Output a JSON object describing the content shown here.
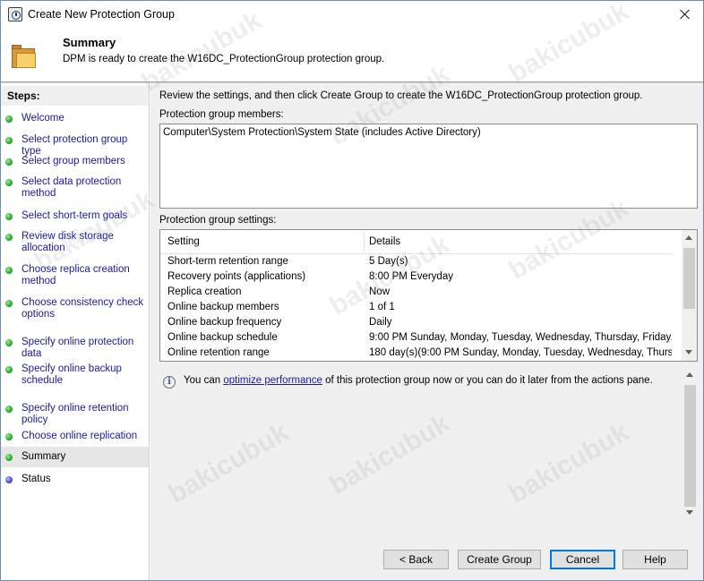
{
  "window": {
    "title": "Create New Protection Group",
    "close_label": "×"
  },
  "header": {
    "title": "Summary",
    "subtitle": "DPM is ready to create the W16DC_ProtectionGroup protection group."
  },
  "steps": {
    "header": "Steps:",
    "items": [
      {
        "label": "Welcome",
        "state": "done"
      },
      {
        "label": "Select protection group type",
        "state": "done"
      },
      {
        "label": "Select group members",
        "state": "done"
      },
      {
        "label": "Select data protection method",
        "state": "done"
      },
      {
        "label": "Select short-term goals",
        "state": "done"
      },
      {
        "label": "Review disk storage allocation",
        "state": "done"
      },
      {
        "label": "Choose replica creation method",
        "state": "done"
      },
      {
        "label": "Choose consistency check options",
        "state": "done"
      },
      {
        "label": "Specify online protection data",
        "state": "done"
      },
      {
        "label": "Specify online backup schedule",
        "state": "done"
      },
      {
        "label": "Specify online retention policy",
        "state": "done"
      },
      {
        "label": "Choose online replication",
        "state": "done"
      },
      {
        "label": "Summary",
        "state": "current"
      },
      {
        "label": "Status",
        "state": "pending"
      }
    ]
  },
  "main": {
    "review_text": "Review the settings, and then click Create Group to create the W16DC_ProtectionGroup protection group.",
    "members_label": "Protection group members:",
    "members_value": "Computer\\System Protection\\System State (includes Active Directory)",
    "settings_label": "Protection group settings:",
    "settings_columns": [
      "Setting",
      "Details"
    ],
    "settings_rows": [
      [
        "Short-term retention range",
        "5 Day(s)"
      ],
      [
        "Recovery points (applications)",
        "8:00 PM Everyday"
      ],
      [
        "Replica creation",
        "Now"
      ],
      [
        "Online backup members",
        "1 of 1"
      ],
      [
        "Online backup frequency",
        "Daily"
      ],
      [
        "Online backup schedule",
        "9:00 PM Sunday, Monday, Tuesday, Wednesday, Thursday, Friday, ..."
      ],
      [
        "Online retention range",
        "180 day(s)(9:00 PM Sunday, Monday, Tuesday, Wednesday, Thurs..."
      ]
    ],
    "info_prefix": "You can ",
    "info_link": "optimize performance",
    "info_suffix": " of this protection group now or you can do it later from the actions pane."
  },
  "footer": {
    "back": "< Back",
    "create": "Create Group",
    "cancel": "Cancel",
    "help": "Help"
  },
  "watermark": "bakicubuk",
  "colors": {
    "link": "#1a1aa0",
    "done_dot": "#1f9a1f",
    "pending_dot": "#3b3bb8",
    "panel_bg": "#f0f0f0",
    "default_button_border": "#0078d7"
  }
}
